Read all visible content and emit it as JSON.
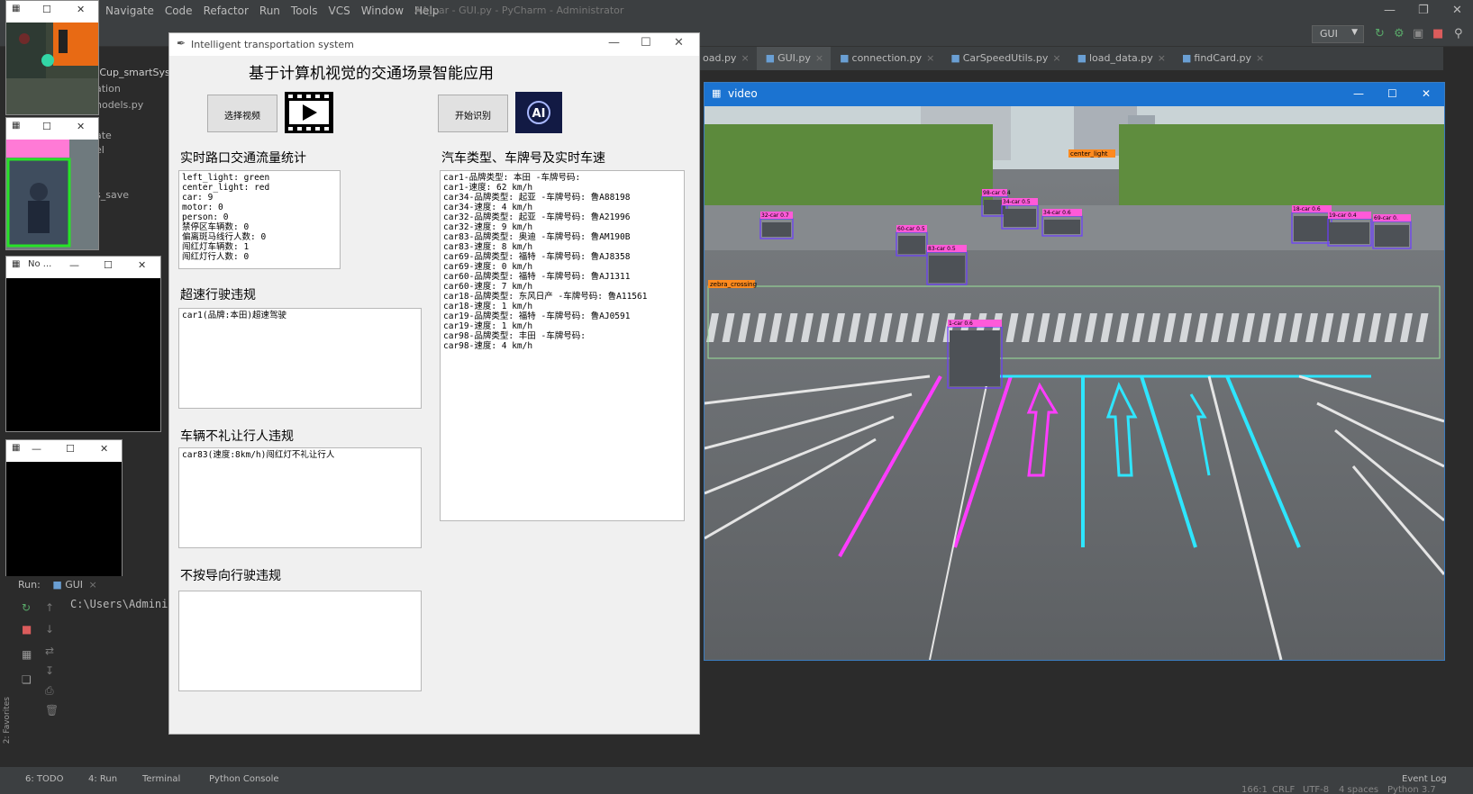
{
  "ide": {
    "menu": [
      "Navigate",
      "Code",
      "Refactor",
      "Run",
      "Tools",
      "VCS",
      "Window",
      "Help"
    ],
    "window_title": "AA_car - GUI.py - PyCharm - Administrator",
    "run_config": "GUI",
    "tabs": [
      {
        "label": "oad.py",
        "active": false
      },
      {
        "label": "GUI.py",
        "active": true
      },
      {
        "label": "connection.py",
        "active": false
      },
      {
        "label": "CarSpeedUtils.py",
        "active": false
      },
      {
        "label": "load_data.py",
        "active": false
      },
      {
        "label": "findCard.py",
        "active": false
      }
    ],
    "project_items": [
      "tCup_smartSys",
      "ation",
      "nodels.py",
      "ate",
      "el",
      "s_save"
    ],
    "run_label": "Run:",
    "run_tab": "GUI",
    "console_line": "C:\\Users\\Adminis",
    "favorites_label": "2: Favorites",
    "status_tabs": [
      "6: TODO",
      "4: Run",
      "Terminal",
      "Python Console"
    ],
    "event_log": "Event Log",
    "status_right": [
      "166:1",
      "CRLF",
      "UTF-8",
      "4 spaces",
      "Python 3.7"
    ]
  },
  "mini_windows": [
    {
      "title": "No ..."
    }
  ],
  "app": {
    "window_title": "Intelligent transportation system",
    "heading": "基于计算机视觉的交通场景智能应用",
    "select_video_button": "选择视频",
    "start_button": "开始识别",
    "ai_logo_text": "AI",
    "sections": {
      "traffic_stats": "实时路口交通流量统计",
      "speeding": "超速行驶违规",
      "no_yield": "车辆不礼让行人违规",
      "wrong_lane": "不按导向行驶违规",
      "vehicle_info": "汽车类型、车牌号及实时车速"
    },
    "traffic_stats_lines": [
      "left_light: green",
      "center_light: red",
      "car: 9",
      "motor: 0",
      "person: 0",
      "禁停区车辆数: 0",
      "偏离斑马线行人数: 0",
      "闯红灯车辆数: 1",
      "闯红灯行人数: 0"
    ],
    "speeding_lines": [
      "car1(品牌:本田)超速驾驶"
    ],
    "no_yield_lines": [
      "car83(速度:8km/h)闯红灯不礼让行人"
    ],
    "wrong_lane_lines": [],
    "vehicle_info_lines": [
      "car1-品牌类型: 本田 -车牌号码:",
      "car1-速度: 62 km/h",
      "car34-品牌类型: 起亚 -车牌号码: 鲁A88198",
      "car34-速度: 4 km/h",
      "car32-品牌类型: 起亚 -车牌号码: 鲁A21996",
      "car32-速度: 9 km/h",
      "car83-品牌类型: 奥迪 -车牌号码: 鲁AM190B",
      "car83-速度: 8 km/h",
      "car69-品牌类型: 福特 -车牌号码: 鲁AJ8358",
      "car69-速度: 0 km/h",
      "car60-品牌类型: 福特 -车牌号码: 鲁AJ1311",
      "car60-速度: 7 km/h",
      "car18-品牌类型: 东风日产 -车牌号码: 鲁A11561",
      "car18-速度: 1 km/h",
      "car19-品牌类型: 福特 -车牌号码: 鲁AJ0591",
      "car19-速度: 1 km/h",
      "car98-品牌类型: 丰田 -车牌号码:",
      "car98-速度: 4 km/h"
    ]
  },
  "video": {
    "title": "video",
    "zebra_label": "zebra_crossing",
    "light_label": "center_light",
    "detections": [
      {
        "label": "32-car 0.7"
      },
      {
        "label": "98-car 0.4"
      },
      {
        "label": "34-car 0.5"
      },
      {
        "label": "34-car 0.6"
      },
      {
        "label": "60-car 0.5"
      },
      {
        "label": "83-car 0.5"
      },
      {
        "label": "1-car 0.6"
      },
      {
        "label": "18-car 0.6"
      },
      {
        "label": "19-car 0.4"
      },
      {
        "label": "69-car 0."
      }
    ]
  },
  "colors": {
    "ide_bg": "#2b2b2b",
    "ide_bar": "#3c3f41",
    "tk_bg": "#f0f0f0",
    "video_title": "#1b73d1",
    "lane_magenta": "#ff3cff",
    "lane_cyan": "#2ee6ff",
    "box_purple": "#6c3cff",
    "label_pink": "#ff5ad9"
  }
}
